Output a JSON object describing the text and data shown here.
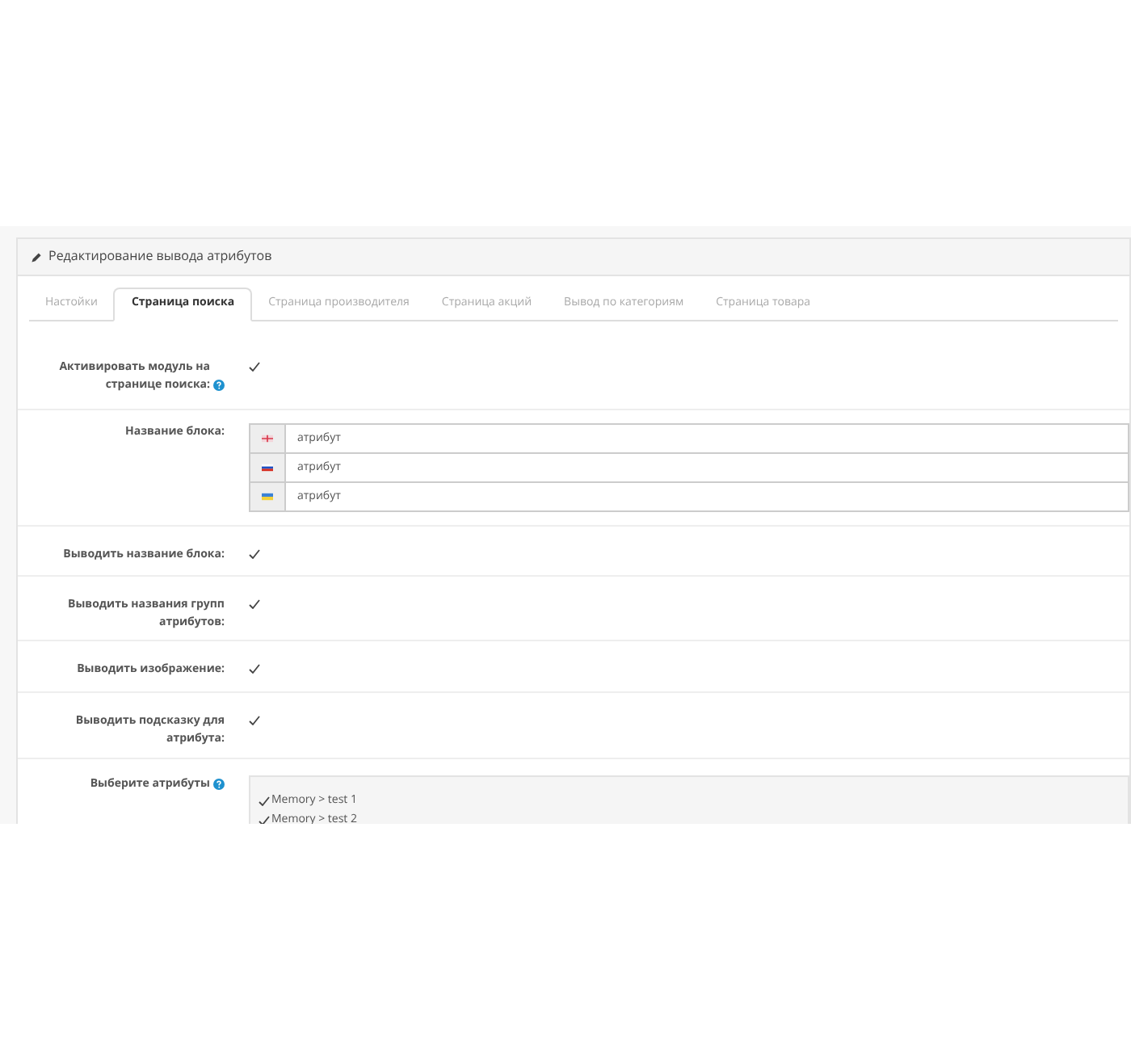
{
  "panel": {
    "title": "Редактирование вывода атрибутов"
  },
  "tabs": [
    {
      "label": "Настойки",
      "selected": false
    },
    {
      "label": "Страница поиска",
      "selected": true
    },
    {
      "label": "Страница производителя",
      "selected": false
    },
    {
      "label": "Страница акций",
      "selected": false
    },
    {
      "label": "Вывод по категориям",
      "selected": false
    },
    {
      "label": "Страница товара",
      "selected": false
    }
  ],
  "rows": [
    {
      "kind": "checkbox",
      "label": "Активировать модуль на странице поиска:",
      "help": true,
      "checked": true
    },
    {
      "kind": "langs",
      "label": "Название блока:",
      "values": [
        "атрибут",
        "атрибут",
        "атрибут"
      ]
    },
    {
      "kind": "checkbox",
      "label": "Выводить название блока:",
      "checked": true
    },
    {
      "kind": "checkbox",
      "label": "Выводить названия групп атрибутов:",
      "checked": true
    },
    {
      "kind": "checkbox",
      "label": "Выводить изображение:",
      "checked": true
    },
    {
      "kind": "checkbox",
      "label": "Выводить подсказку для атрибута:",
      "checked": true
    },
    {
      "kind": "list",
      "label": "Выберите атрибуты",
      "help": true,
      "items": [
        {
          "label": "Memory > test 1",
          "checked": true
        },
        {
          "label": "Memory > test 2",
          "checked": true
        }
      ]
    }
  ]
}
